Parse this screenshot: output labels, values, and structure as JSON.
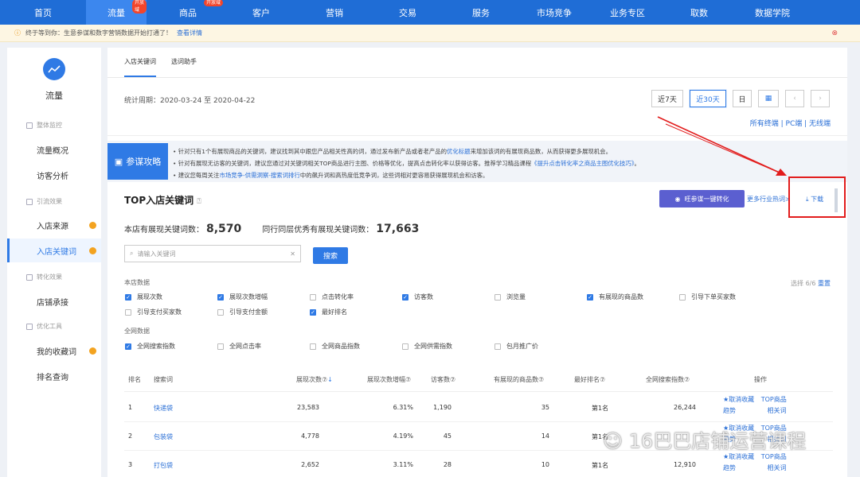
{
  "topnav": {
    "items": [
      {
        "label": "首页",
        "badge": ""
      },
      {
        "label": "流量",
        "badge": "开放域"
      },
      {
        "label": "商品",
        "badge": "开放域"
      },
      {
        "label": "客户",
        "badge": ""
      },
      {
        "label": "营销",
        "badge": ""
      },
      {
        "label": "交易",
        "badge": ""
      },
      {
        "label": "服务",
        "badge": ""
      },
      {
        "label": "市场竞争",
        "badge": ""
      },
      {
        "label": "业务专区",
        "badge": ""
      },
      {
        "label": "取数",
        "badge": ""
      },
      {
        "label": "数据学院",
        "badge": ""
      }
    ],
    "active_index": 1
  },
  "notice": {
    "text": "终于等到你：生意参谋和数字营销数据开始打通了！",
    "link": "查看详情",
    "close_icon": "close-circle-icon"
  },
  "sidebar": {
    "title": "流量",
    "groups": [
      {
        "label": "整体监控",
        "items": [
          {
            "label": "流量概况",
            "dot": false
          },
          {
            "label": "访客分析",
            "dot": false
          }
        ]
      },
      {
        "label": "引流效果",
        "items": [
          {
            "label": "入店来源",
            "dot": true
          },
          {
            "label": "入店关键词",
            "dot": true,
            "active": true
          }
        ]
      },
      {
        "label": "转化效果",
        "items": [
          {
            "label": "店铺承接",
            "dot": false
          }
        ]
      },
      {
        "label": "优化工具",
        "items": [
          {
            "label": "我的收藏词",
            "dot": true
          },
          {
            "label": "排名查询",
            "dot": false
          }
        ]
      }
    ]
  },
  "tabs": [
    "入店关键词",
    "选词助手"
  ],
  "period": {
    "label": "统计周期：2020-03-24 至 2020-04-22",
    "buttons": [
      "近7天",
      "近30天",
      "日"
    ],
    "selected": "近30天",
    "devices": "所有终端 | PC端 | 无线端"
  },
  "tips": {
    "badge": "参谋攻略",
    "lines": [
      {
        "pre": "• 针对只有1个有展现商品的关键词，建议找到其中跟您产品相关性高的词，通过发布新产品或者老产品的",
        "link": "优化标题",
        "post": "来增加该词的有展现商品数，从而获得更多展现机会。"
      },
      {
        "pre": "• 针对有展现无访客的关键词，建议您通过对关键词相关TOP商品进行主图、价格等优化，提高点击转化率以获得访客。推荐学习精品课程",
        "link": "《提升点击转化率之商品主图优化技巧》",
        "post": "。"
      },
      {
        "pre": "• 建议您每周关注",
        "link": "市场竞争-供需洞察-搜索词排行",
        "post": "中的飙升词和高热度低竞争词，这些词相对更容易获得展现机会和访客。"
      }
    ]
  },
  "section": {
    "title": "TOP入店关键词",
    "convert_button": "旺参谋一键转化",
    "more_link": "更多行业热词>",
    "download_link": "下载"
  },
  "stats": {
    "shop_label": "本店有展现关键词数：",
    "shop_value": "8,570",
    "peer_label": "同行同层优秀有展现关键词数：",
    "peer_value": "17,663"
  },
  "search": {
    "placeholder": "请输入关键词",
    "button": "搜索"
  },
  "filters": {
    "shop_label": "本店数据",
    "selected_text": "选择 6/6",
    "reset_link": "重置",
    "shop_items": [
      {
        "label": "展现次数",
        "checked": true
      },
      {
        "label": "展现次数增幅",
        "checked": true
      },
      {
        "label": "点击转化率",
        "checked": false
      },
      {
        "label": "访客数",
        "checked": true
      },
      {
        "label": "浏览量",
        "checked": false
      },
      {
        "label": "有展现的商品数",
        "checked": true
      },
      {
        "label": "引导下单买家数",
        "checked": false
      },
      {
        "label": "引导支付买家数",
        "checked": false
      },
      {
        "label": "引导支付金额",
        "checked": false
      },
      {
        "label": "最好排名",
        "checked": true
      }
    ],
    "net_label": "全网数据",
    "net_items": [
      {
        "label": "全网搜索指数",
        "checked": true
      },
      {
        "label": "全网点击率",
        "checked": false
      },
      {
        "label": "全网商品指数",
        "checked": false
      },
      {
        "label": "全网供需指数",
        "checked": false
      },
      {
        "label": "包月推广价",
        "checked": false
      }
    ]
  },
  "table": {
    "headers": [
      "排名",
      "搜索词",
      "展现次数⑦",
      "展现次数增幅⑦",
      "访客数⑦",
      "有展现的商品数⑦",
      "最好排名⑦",
      "全网搜索指数⑦",
      "操作"
    ],
    "rows": [
      {
        "rank": "1",
        "keyword": "快递袋",
        "impressions": "23,583",
        "growth": "6.31%",
        "visitors": "1,190",
        "products": "35",
        "best_rank": "第1名",
        "search_index": "26,244",
        "op1": "★取消收藏",
        "op2": "TOP商品",
        "op3": "趋势",
        "op4": "相关词"
      },
      {
        "rank": "2",
        "keyword": "包装袋",
        "impressions": "4,778",
        "growth": "4.19%",
        "visitors": "45",
        "products": "14",
        "best_rank": "第1名",
        "search_index": "",
        "op1": "★取消收藏",
        "op2": "TOP商品",
        "op3": "趋势",
        "op4": "相关词"
      },
      {
        "rank": "3",
        "keyword": "打包袋",
        "impressions": "2,652",
        "growth": "3.11%",
        "visitors": "28",
        "products": "10",
        "best_rank": "第1名",
        "search_index": "12,910",
        "op1": "★取消收藏",
        "op2": "TOP商品",
        "op3": "趋势",
        "op4": "相关词"
      }
    ]
  },
  "watermark": "16巴巴店铺运营课程",
  "colors": {
    "nav_bg": "#1f6dd6",
    "accent": "#2f7ae5",
    "annotation": "#e21c1c",
    "dot": "#f3a320"
  }
}
